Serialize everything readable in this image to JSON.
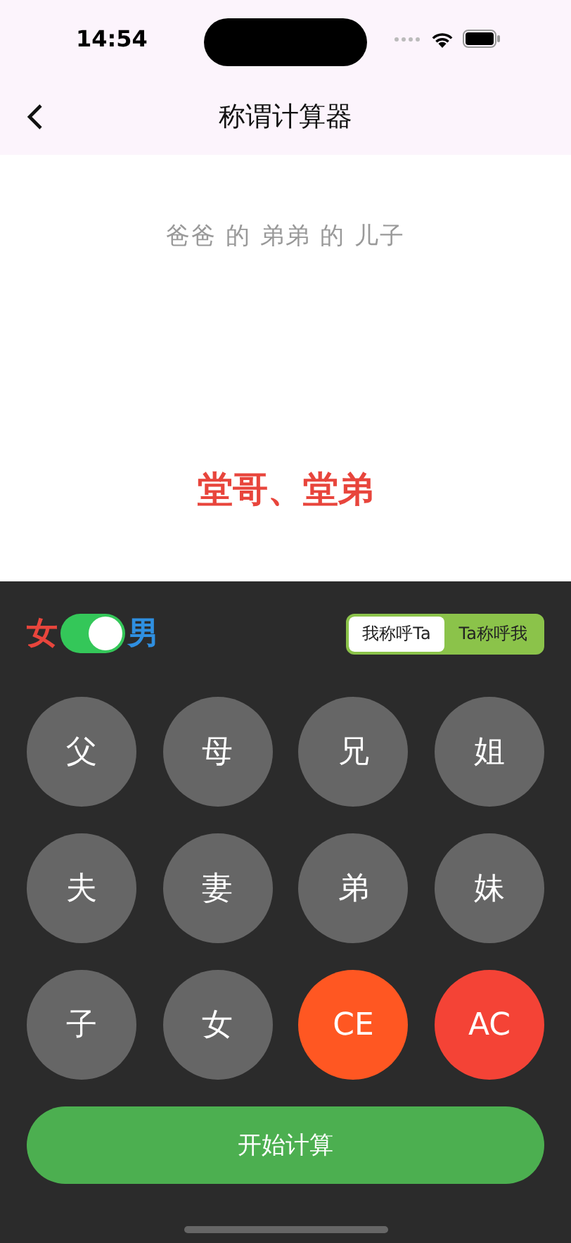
{
  "status_bar": {
    "time": "14:54"
  },
  "nav": {
    "title": "称谓计算器"
  },
  "expression": "爸爸 的 弟弟 的 儿子",
  "result": "堂哥、堂弟",
  "gender": {
    "female_label": "女",
    "male_label": "男",
    "on": true
  },
  "mode_tabs": [
    {
      "label": "我称呼Ta",
      "selected": true
    },
    {
      "label": "Ta称呼我",
      "selected": false
    }
  ],
  "keys": [
    {
      "label": "父",
      "kind": "relation"
    },
    {
      "label": "母",
      "kind": "relation"
    },
    {
      "label": "兄",
      "kind": "relation"
    },
    {
      "label": "姐",
      "kind": "relation"
    },
    {
      "label": "夫",
      "kind": "relation"
    },
    {
      "label": "妻",
      "kind": "relation"
    },
    {
      "label": "弟",
      "kind": "relation"
    },
    {
      "label": "妹",
      "kind": "relation"
    },
    {
      "label": "子",
      "kind": "relation"
    },
    {
      "label": "女",
      "kind": "relation"
    },
    {
      "label": "CE",
      "kind": "clear_entry"
    },
    {
      "label": "AC",
      "kind": "all_clear"
    }
  ],
  "calculate_button": "开始计算"
}
